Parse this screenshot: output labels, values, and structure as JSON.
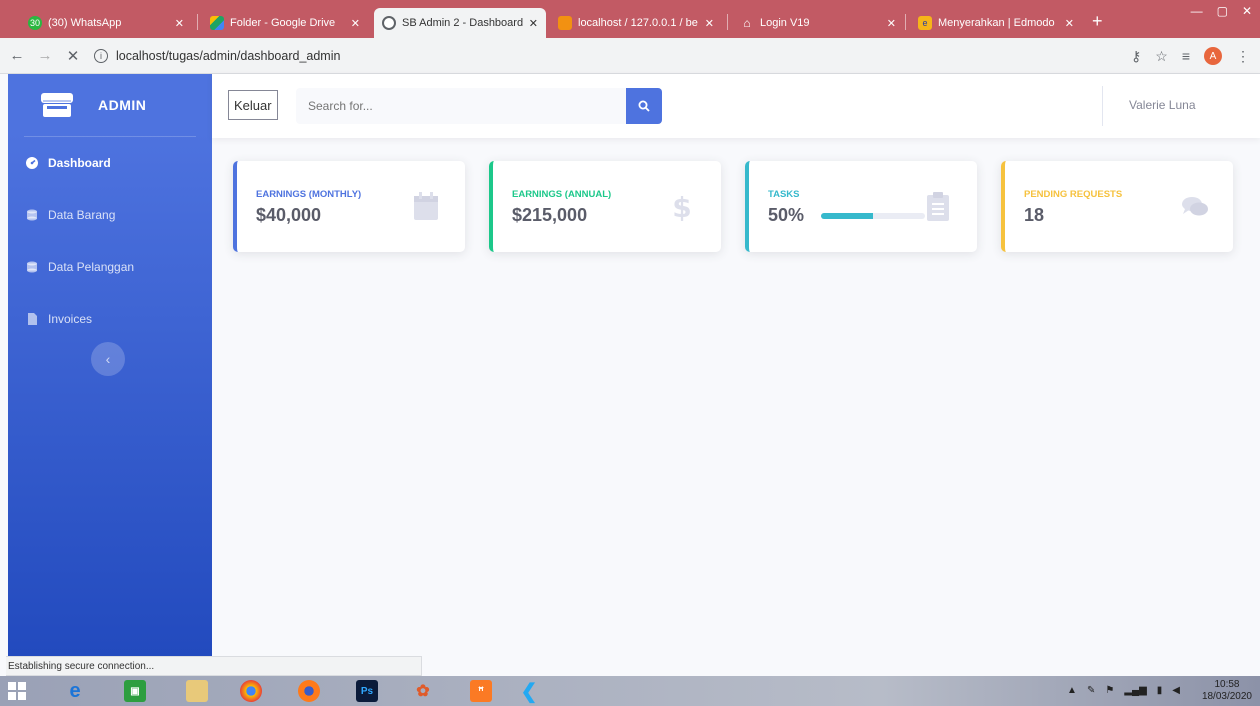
{
  "browser": {
    "tabs": [
      {
        "label": "(30) WhatsApp",
        "active": false
      },
      {
        "label": "Folder - Google Drive",
        "active": false
      },
      {
        "label": "SB Admin 2 - Dashboard",
        "active": true
      },
      {
        "label": "localhost / 127.0.0.1 / be",
        "active": false
      },
      {
        "label": "Login V19",
        "active": false
      },
      {
        "label": "Menyerahkan | Edmodo",
        "active": false
      }
    ],
    "whatsapp_count": "30",
    "url": "localhost/tugas/admin/dashboard_admin",
    "profile_initial": "A",
    "status": "Establishing secure connection..."
  },
  "sidebar": {
    "brand": "ADMIN",
    "items": [
      {
        "label": "Dashboard",
        "active": true
      },
      {
        "label": "Data Barang"
      },
      {
        "label": "Data Pelanggan"
      },
      {
        "label": "Invoices"
      }
    ],
    "toggle_glyph": "‹"
  },
  "topbar": {
    "logout_label": "Keluar",
    "search_placeholder": "Search for...",
    "username": "Valerie Luna"
  },
  "cards": [
    {
      "label": "Earnings (Monthly)",
      "value": "$40,000",
      "color": "#4e73df",
      "icon": "calendar-icon"
    },
    {
      "label": "Earnings (Annual)",
      "value": "$215,000",
      "color": "#1cc88a",
      "icon": "dollar-icon"
    },
    {
      "label": "Tasks",
      "value": "50%",
      "progress": 0.5,
      "color": "#36b9cc",
      "icon": "clipboard-icon"
    },
    {
      "label": "Pending Requests",
      "value": "18",
      "color": "#f6c23e",
      "icon": "comments-icon"
    }
  ],
  "taskbar": {
    "time": "10:58",
    "date": "18/03/2020"
  }
}
